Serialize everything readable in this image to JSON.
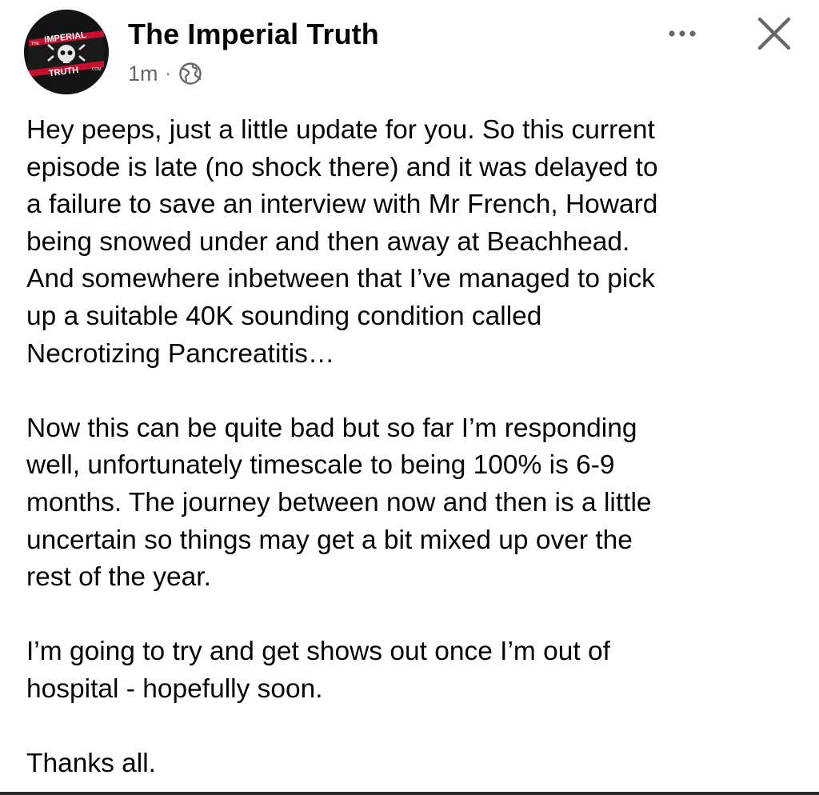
{
  "post": {
    "page_name": "The Imperial Truth",
    "timestamp": "1m",
    "separator": "·",
    "audience_icon": "globe-icon",
    "avatar": {
      "logo_text_top": "IMPERIAL",
      "logo_text_bottom": "TRUTH",
      "logo_text_the": "THE",
      "logo_text_com": ".COM"
    },
    "paragraphs": [
      "Hey peeps, just a little update for you. So this current\nepisode is late (no shock there) and it was delayed to\na failure to save an interview with Mr French, Howard\nbeing snowed under and then away at Beachhead.\nAnd somewhere inbetween that I’ve managed to pick\nup a suitable 40K sounding condition called\nNecrotizing Pancreatitis…",
      "Now this can be quite bad but so far I’m responding\nwell, unfortunately timescale to being 100% is 6-9\nmonths. The journey between now and then is a little\nuncertain so things may get a bit mixed up over the\nrest of the year.",
      "I’m going to try and get shows out once I’m out of\nhospital - hopefully soon.",
      "Thanks all."
    ]
  },
  "toolbar": {
    "more_icon": "more-options-icon",
    "close_icon": "close-icon"
  },
  "colors": {
    "text": "#050505",
    "secondary": "#65676b",
    "avatar_bg": "#141414",
    "brand_red": "#c8102e"
  }
}
